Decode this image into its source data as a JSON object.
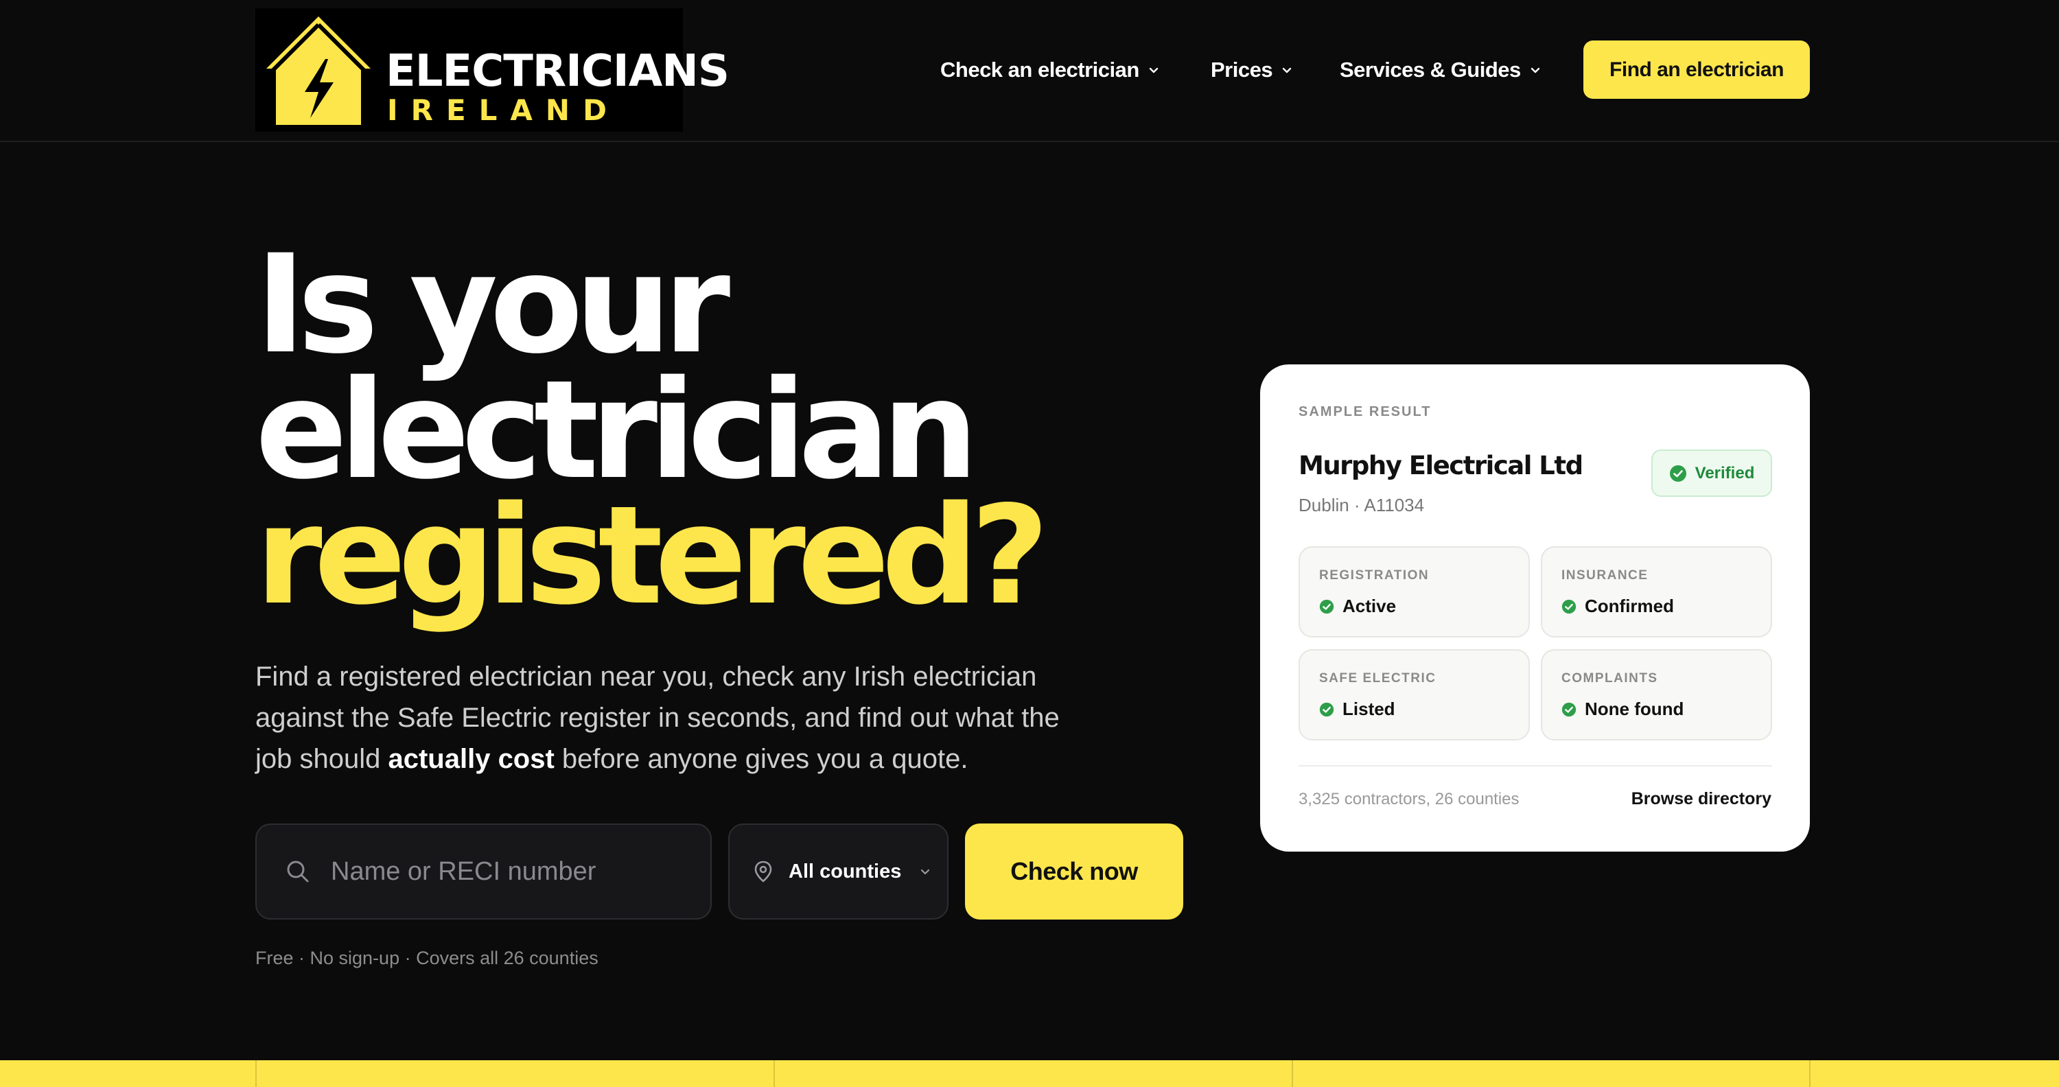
{
  "logo": {
    "word1": "ELECTRICIANS",
    "word2": "IRELAND",
    "icon": "house-lightning-icon"
  },
  "nav": {
    "items": [
      {
        "label": "Check an electrician",
        "icon": "chevron-down-icon"
      },
      {
        "label": "Prices",
        "icon": "chevron-down-icon"
      },
      {
        "label": "Services & Guides",
        "icon": "chevron-down-icon"
      }
    ],
    "cta": "Find an electrician"
  },
  "hero": {
    "line1": "Is your",
    "line2": "electrician",
    "line3": "registered?",
    "sub_part1": "Find a registered electrician near you, check any Irish electrician against the Safe Electric register in seconds, and find out what the job should ",
    "sub_bold": "actually cost",
    "sub_part2": " before anyone gives you a quote."
  },
  "search": {
    "placeholder": "Name or RECI number",
    "value": "",
    "icon": "search-icon",
    "county_label": "All counties",
    "county_icon": "map-pin-icon",
    "button": "Check now",
    "note": "Free · No sign-up · Covers all 26 counties"
  },
  "card": {
    "eyebrow": "SAMPLE RESULT",
    "company": "Murphy Electrical Ltd",
    "location": "Dublin · A11034",
    "badge": "Verified",
    "tiles": [
      {
        "label": "REGISTRATION",
        "value": "Active"
      },
      {
        "label": "INSURANCE",
        "value": "Confirmed"
      },
      {
        "label": "SAFE ELECTRIC",
        "value": "Listed"
      },
      {
        "label": "COMPLAINTS",
        "value": "None found"
      }
    ],
    "stats": "3,325 contractors, 26 counties",
    "browse": "Browse directory"
  },
  "colors": {
    "accent": "#fde64b",
    "background": "#0b0b0b",
    "success": "#2e9e4a"
  }
}
